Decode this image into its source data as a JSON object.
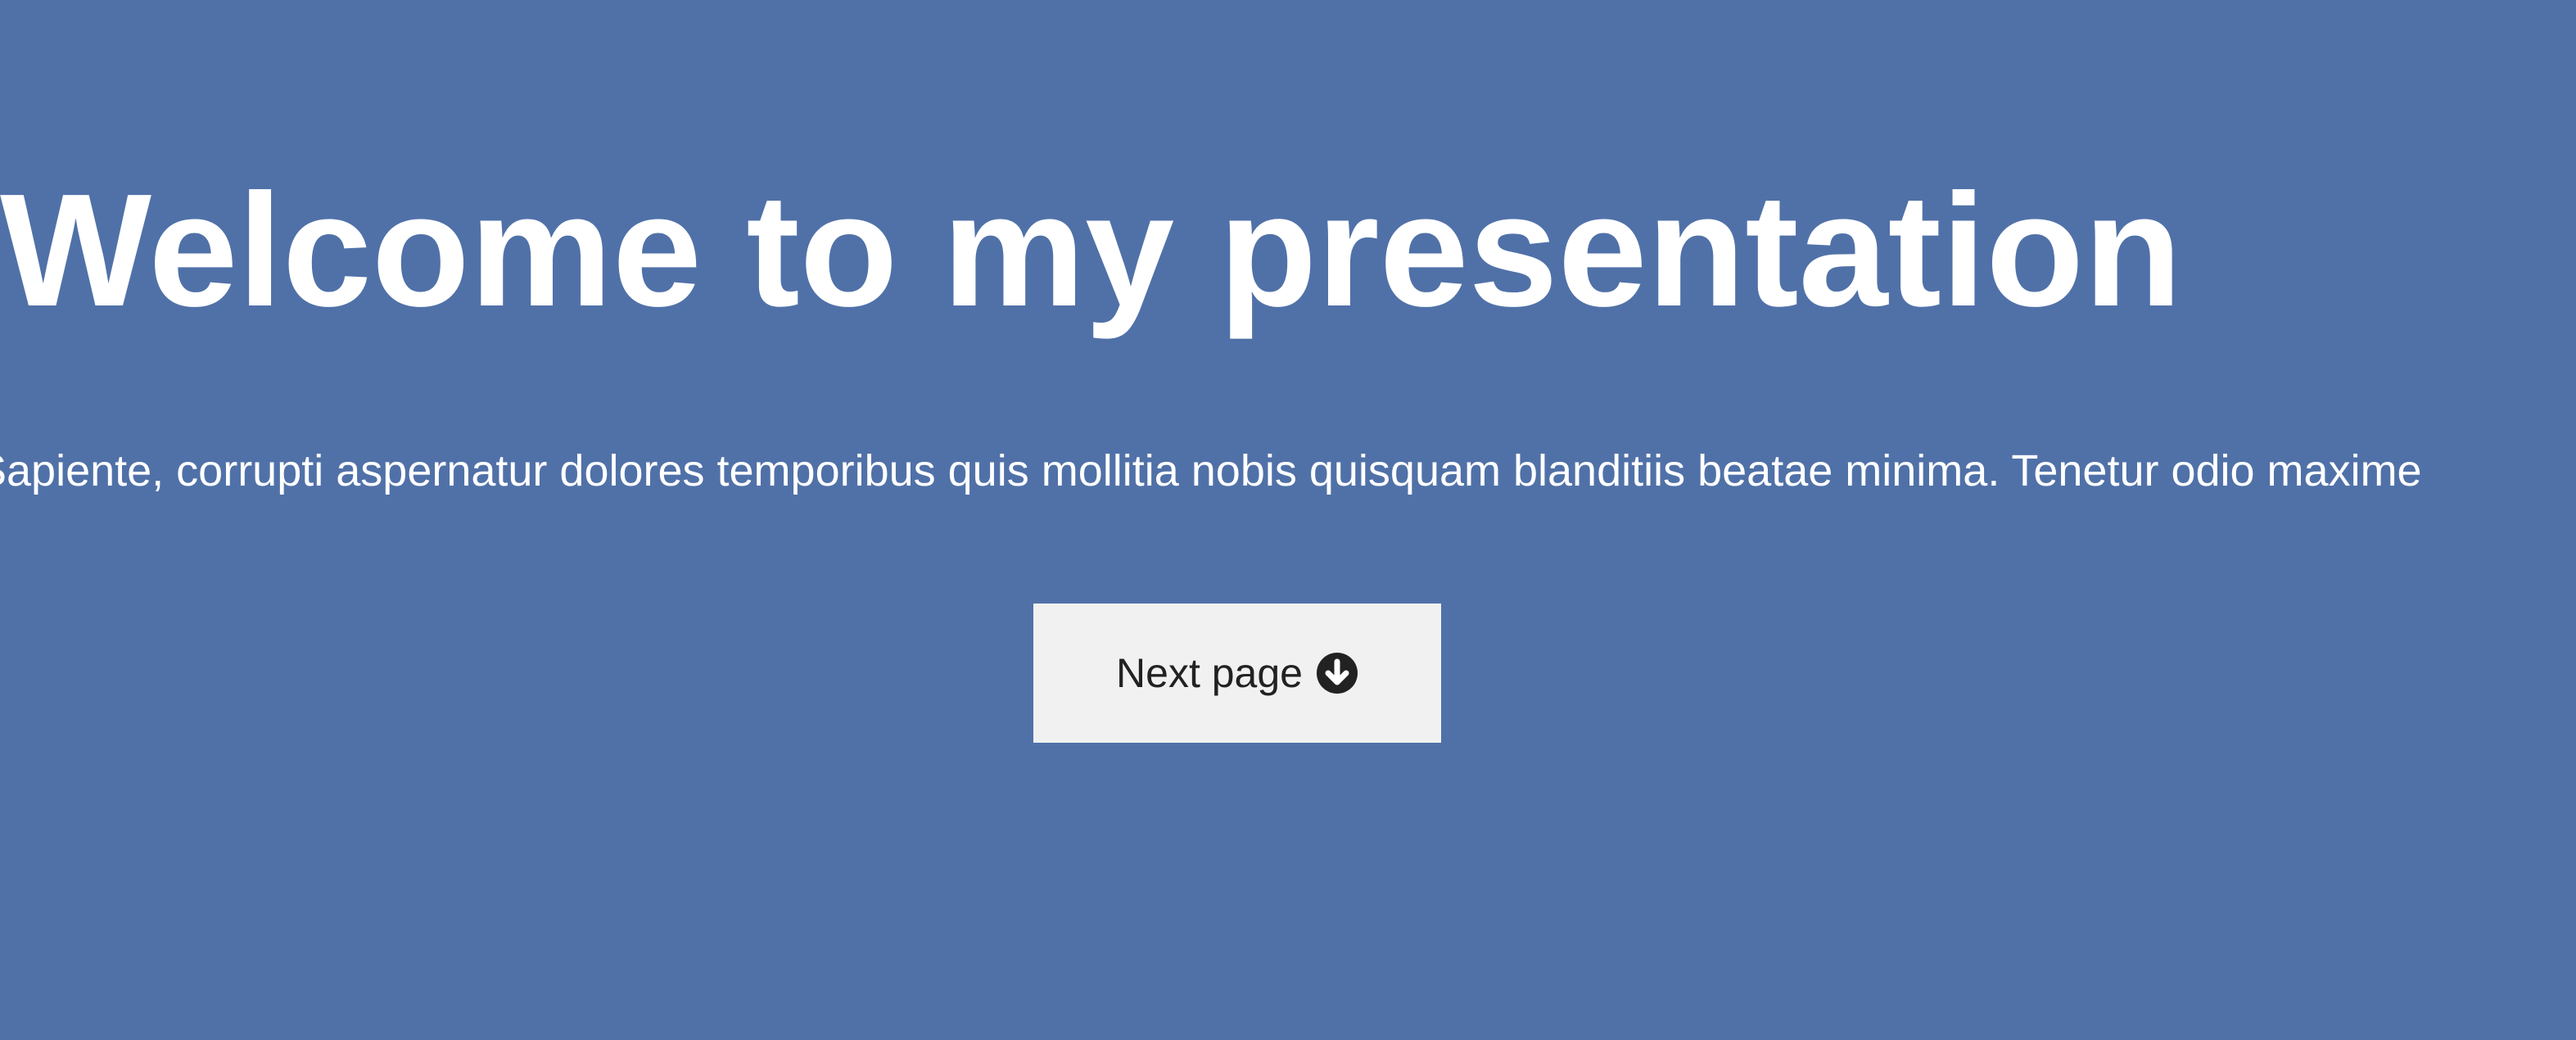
{
  "slide": {
    "title": "Welcome to my presentation",
    "body": "Sapiente, corrupti aspernatur dolores temporibus quis mollitia nobis quisquam blanditiis beatae minima. Tenetur odio maxime",
    "next_button": {
      "label": "Next page",
      "icon": "arrow-circle-down-icon"
    }
  },
  "colors": {
    "background": "#5071a8",
    "text": "#ffffff",
    "button_bg": "#f1f1f1",
    "button_text": "#222222"
  }
}
